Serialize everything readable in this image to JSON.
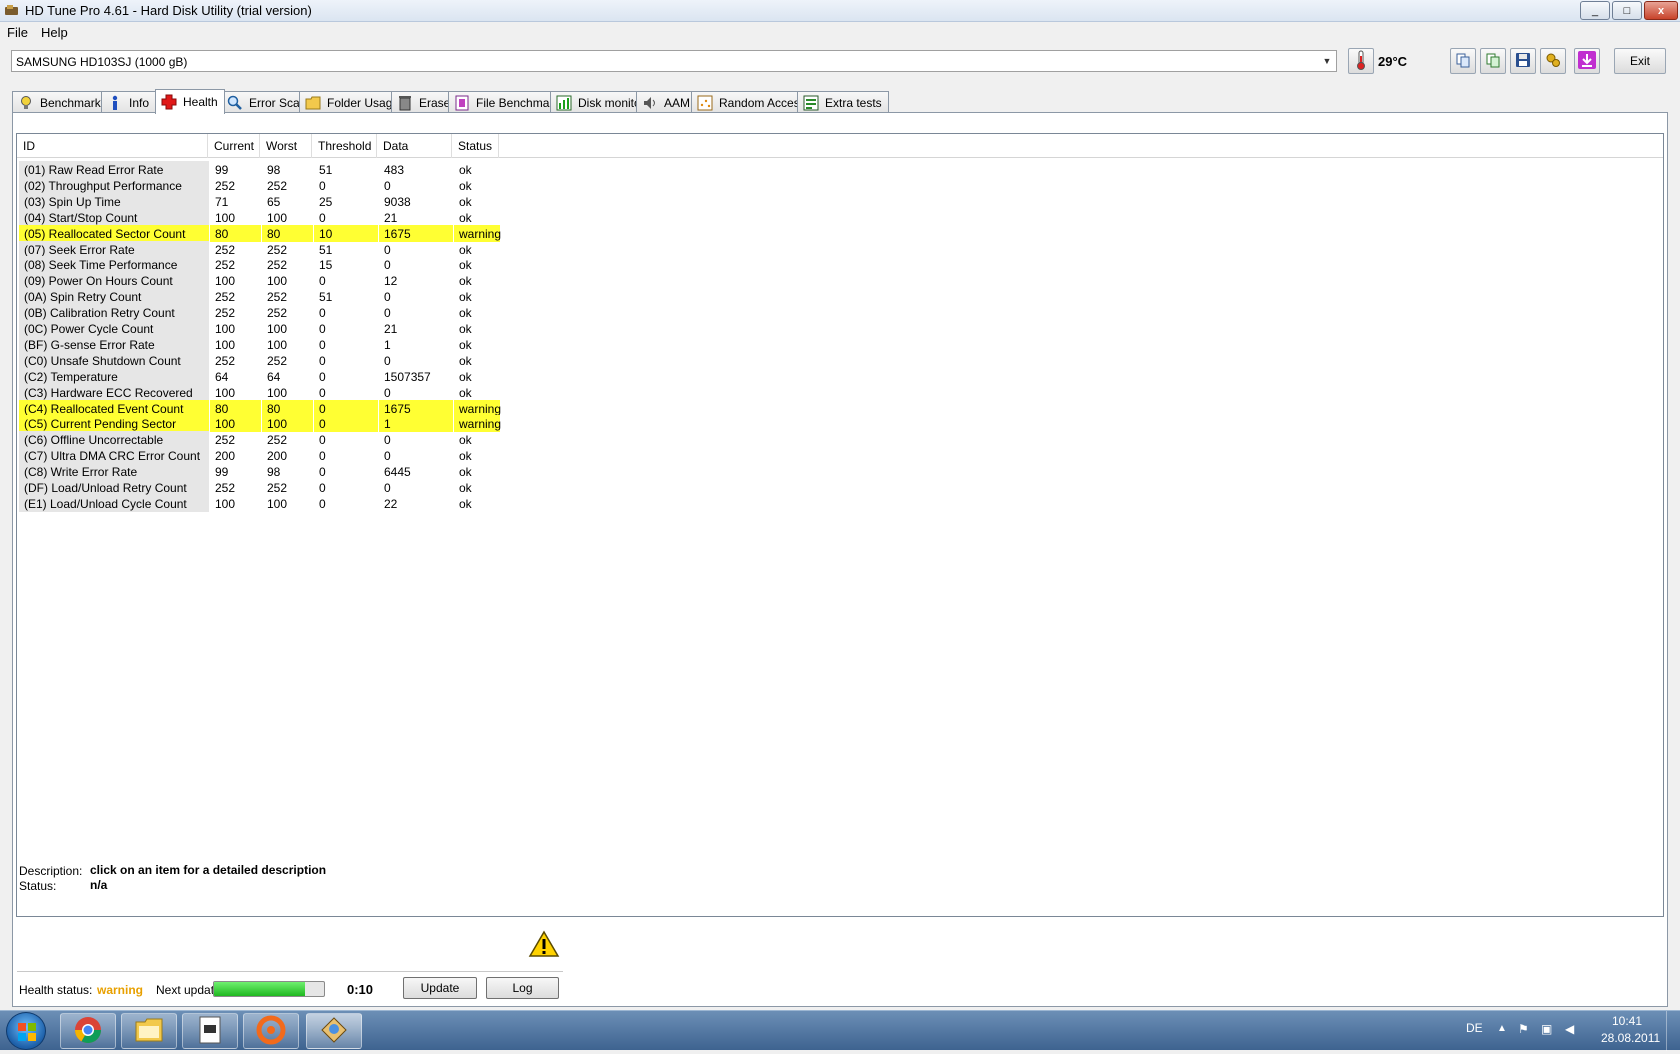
{
  "window": {
    "title": "HD Tune Pro 4.61 - Hard Disk Utility (trial version)",
    "minimize": "_",
    "maximize": "□",
    "close": "x"
  },
  "menu": {
    "file": "File",
    "help": "Help"
  },
  "toolbar": {
    "drive": "SAMSUNG HD103SJ (1000 gB)",
    "temperature": "29°C",
    "exit_label": "Exit"
  },
  "tabs": [
    {
      "label": "Benchmark",
      "icon": "benchmark-bulb-icon"
    },
    {
      "label": "Info",
      "icon": "info-icon"
    },
    {
      "label": "Health",
      "icon": "health-cross-icon",
      "active": true
    },
    {
      "label": "Error Scan",
      "icon": "magnifier-icon"
    },
    {
      "label": "Folder Usage",
      "icon": "folder-icon"
    },
    {
      "label": "Erase",
      "icon": "trash-icon"
    },
    {
      "label": "File Benchmark",
      "icon": "file-benchmark-icon"
    },
    {
      "label": "Disk monitor",
      "icon": "disk-monitor-icon"
    },
    {
      "label": "AAM",
      "icon": "speaker-icon"
    },
    {
      "label": "Random Access",
      "icon": "random-access-icon"
    },
    {
      "label": "Extra tests",
      "icon": "extra-tests-icon"
    }
  ],
  "smart": {
    "columns": [
      "ID",
      "Current",
      "Worst",
      "Threshold",
      "Data",
      "Status"
    ],
    "rows": [
      {
        "id": "(01) Raw Read Error Rate",
        "current": "99",
        "worst": "98",
        "threshold": "51",
        "data": "483",
        "status": "ok"
      },
      {
        "id": "(02) Throughput Performance",
        "current": "252",
        "worst": "252",
        "threshold": "0",
        "data": "0",
        "status": "ok"
      },
      {
        "id": "(03) Spin Up Time",
        "current": "71",
        "worst": "65",
        "threshold": "25",
        "data": "9038",
        "status": "ok"
      },
      {
        "id": "(04) Start/Stop Count",
        "current": "100",
        "worst": "100",
        "threshold": "0",
        "data": "21",
        "status": "ok"
      },
      {
        "id": "(05) Reallocated Sector Count",
        "current": "80",
        "worst": "80",
        "threshold": "10",
        "data": "1675",
        "status": "warning"
      },
      {
        "id": "(07) Seek Error Rate",
        "current": "252",
        "worst": "252",
        "threshold": "51",
        "data": "0",
        "status": "ok"
      },
      {
        "id": "(08) Seek Time Performance",
        "current": "252",
        "worst": "252",
        "threshold": "15",
        "data": "0",
        "status": "ok"
      },
      {
        "id": "(09) Power On Hours Count",
        "current": "100",
        "worst": "100",
        "threshold": "0",
        "data": "12",
        "status": "ok"
      },
      {
        "id": "(0A) Spin Retry Count",
        "current": "252",
        "worst": "252",
        "threshold": "51",
        "data": "0",
        "status": "ok"
      },
      {
        "id": "(0B) Calibration Retry Count",
        "current": "252",
        "worst": "252",
        "threshold": "0",
        "data": "0",
        "status": "ok"
      },
      {
        "id": "(0C) Power Cycle Count",
        "current": "100",
        "worst": "100",
        "threshold": "0",
        "data": "21",
        "status": "ok"
      },
      {
        "id": "(BF) G-sense Error Rate",
        "current": "100",
        "worst": "100",
        "threshold": "0",
        "data": "1",
        "status": "ok"
      },
      {
        "id": "(C0) Unsafe Shutdown Count",
        "current": "252",
        "worst": "252",
        "threshold": "0",
        "data": "0",
        "status": "ok"
      },
      {
        "id": "(C2) Temperature",
        "current": "64",
        "worst": "64",
        "threshold": "0",
        "data": "1507357",
        "status": "ok"
      },
      {
        "id": "(C3) Hardware ECC Recovered",
        "current": "100",
        "worst": "100",
        "threshold": "0",
        "data": "0",
        "status": "ok"
      },
      {
        "id": "(C4) Reallocated Event Count",
        "current": "80",
        "worst": "80",
        "threshold": "0",
        "data": "1675",
        "status": "warning"
      },
      {
        "id": "(C5) Current Pending Sector",
        "current": "100",
        "worst": "100",
        "threshold": "0",
        "data": "1",
        "status": "warning"
      },
      {
        "id": "(C6) Offline Uncorrectable",
        "current": "252",
        "worst": "252",
        "threshold": "0",
        "data": "0",
        "status": "ok"
      },
      {
        "id": "(C7) Ultra DMA CRC Error Count",
        "current": "200",
        "worst": "200",
        "threshold": "0",
        "data": "0",
        "status": "ok"
      },
      {
        "id": "(C8) Write Error Rate",
        "current": "99",
        "worst": "98",
        "threshold": "0",
        "data": "6445",
        "status": "ok"
      },
      {
        "id": "(DF) Load/Unload Retry Count",
        "current": "252",
        "worst": "252",
        "threshold": "0",
        "data": "0",
        "status": "ok"
      },
      {
        "id": "(E1) Load/Unload Cycle Count",
        "current": "100",
        "worst": "100",
        "threshold": "0",
        "data": "22",
        "status": "ok"
      }
    ]
  },
  "details": {
    "description_label": "Description:",
    "description_value": "click on an item for a detailed description",
    "status_label": "Status:",
    "status_value": "n/a"
  },
  "health": {
    "label": "Health status:",
    "value": "warning",
    "value_color": "#e8a000",
    "next_update_label": "Next update:",
    "progress_fraction": 0.83,
    "countdown": "0:10",
    "update_label": "Update",
    "log_label": "Log"
  },
  "colors": {
    "warning_row": "#ffff33",
    "progress_fill": "#2ccc2c"
  },
  "taskbar": {
    "items": [
      "chrome-icon",
      "file-explorer-icon",
      "document-icon",
      "origin-icon",
      "hdtune-icon"
    ],
    "language": "DE",
    "clock_time": "10:41",
    "clock_date": "28.08.2011"
  }
}
